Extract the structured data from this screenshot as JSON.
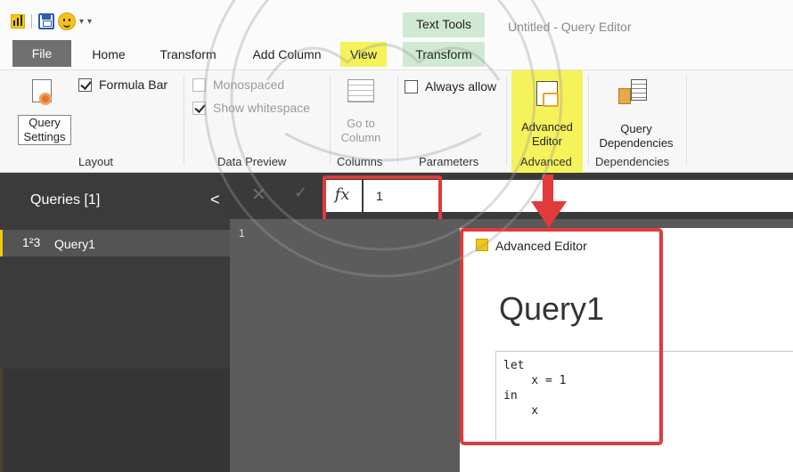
{
  "window": {
    "title": "Untitled - Query Editor",
    "contextual_group": "Text Tools"
  },
  "tabs": [
    {
      "label": "File"
    },
    {
      "label": "Home"
    },
    {
      "label": "Transform"
    },
    {
      "label": "Add Column"
    },
    {
      "label": "View"
    },
    {
      "label": "Transform"
    }
  ],
  "ribbon": {
    "query_settings": {
      "line1": "Query",
      "line2": "Settings"
    },
    "formula_bar": {
      "label": "Formula Bar",
      "checked": true
    },
    "layout_group": "Layout",
    "monospaced": {
      "label": "Monospaced",
      "checked": false
    },
    "show_whitespace": {
      "label": "Show whitespace",
      "checked": true
    },
    "data_preview_group": "Data Preview",
    "go_to_column": {
      "line1": "Go to",
      "line2": "Column"
    },
    "columns_group": "Columns",
    "always_allow": {
      "label": "Always allow",
      "checked": false
    },
    "parameters_group": "Parameters",
    "advanced_editor": {
      "line1": "Advanced",
      "line2": "Editor"
    },
    "advanced_group": "Advanced",
    "query_dependencies": {
      "line1": "Query",
      "line2": "Dependencies"
    },
    "dependencies_group": "Dependencies"
  },
  "queries_pane": {
    "title": "Queries [1]",
    "items": [
      {
        "type_icon": "1²3",
        "name": "Query1"
      }
    ]
  },
  "formula": {
    "fx": "fx",
    "value": "1"
  },
  "grid": {
    "row_number": "1"
  },
  "advanced_editor": {
    "window_title": "Advanced Editor",
    "query_name": "Query1",
    "code_lines": [
      "let",
      "    x = 1",
      "in",
      "    x"
    ]
  },
  "colors": {
    "highlight_yellow": "#f5f25a",
    "callout_red": "#e03a3a",
    "context_green": "#cfe9d3",
    "pane_dark": "#3b3b3b"
  }
}
